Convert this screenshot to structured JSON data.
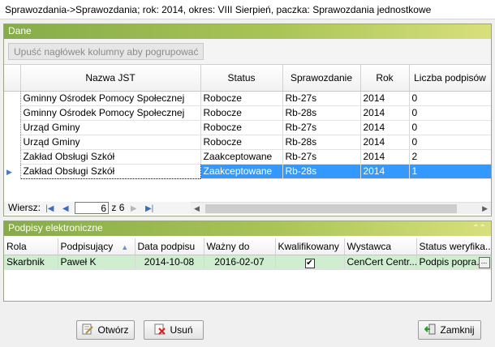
{
  "window": {
    "title": "Sprawozdania->Sprawozdania; rok: 2014, okres: VIII Sierpień, paczka: Sprawozdania jednostkowe"
  },
  "dane": {
    "header": "Dane",
    "group_hint": "Upuść nagłówek kolumny aby pogrupować",
    "columns": [
      "Nazwa JST",
      "Status",
      "Sprawozdanie",
      "Rok",
      "Liczba podpisów"
    ],
    "rows": [
      [
        "Gminny Ośrodek Pomocy Społecznej",
        "Robocze",
        "Rb-27s",
        "2014",
        "0"
      ],
      [
        "Gminny Ośrodek Pomocy Społecznej",
        "Robocze",
        "Rb-28s",
        "2014",
        "0"
      ],
      [
        "Urząd Gminy",
        "Robocze",
        "Rb-27s",
        "2014",
        "0"
      ],
      [
        "Urząd Gminy",
        "Robocze",
        "Rb-28s",
        "2014",
        "0"
      ],
      [
        "Zakład Obsługi Szkół",
        "Zaakceptowane",
        "Rb-27s",
        "2014",
        "2"
      ],
      [
        "Zakład Obsługi Szkół",
        "Zaakceptowane",
        "Rb-28s",
        "2014",
        "1"
      ]
    ],
    "selected_row": 6,
    "nav": {
      "label": "Wiersz:",
      "current": "6",
      "of_label": "z",
      "total": "6"
    }
  },
  "podpisy": {
    "header": "Podpisy elektroniczne",
    "columns": [
      "Rola",
      "Podpisujący",
      "Data podpisu",
      "Ważny do",
      "Kwalifikowany",
      "Wystawca",
      "Status weryfika..."
    ],
    "rows": [
      [
        "Skarbnik",
        "Paweł K",
        "2014-10-08",
        "2016-02-07",
        "✔",
        "CenCert Centr...",
        "Podpis popra..."
      ]
    ]
  },
  "buttons": {
    "open": "Otwórz",
    "delete": "Usuń",
    "close": "Zamknij"
  },
  "colors": {
    "header_gradient_start": "#86ac49",
    "header_gradient_end": "#d8e07c",
    "selection": "#3399ff",
    "signature_row": "#cfeecf"
  }
}
